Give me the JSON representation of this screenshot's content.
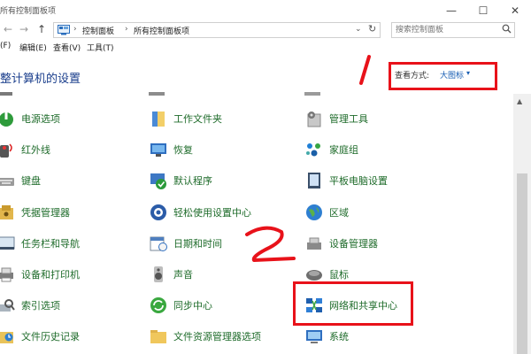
{
  "window": {
    "title": "所有控制面板项",
    "controls": {
      "minimize": "—",
      "maximize": "☐",
      "close": "✕"
    }
  },
  "address_bar": {
    "back": "←",
    "forward": "→",
    "up": "↑",
    "breadcrumb": [
      "控制面板",
      "所有控制面板项"
    ],
    "separator": "›",
    "dropdown": "⌄",
    "refresh": "↻"
  },
  "search": {
    "placeholder": "搜索控制面板"
  },
  "menu": [
    "(F)",
    "编辑(E)",
    "查看(V)",
    "工具(T)"
  ],
  "header": {
    "title": "整计算机的设置",
    "view_by_label": "查看方式:",
    "view_by_value": "大图标",
    "view_by_caret": "▾"
  },
  "annotations": {
    "one": "1",
    "two": "2"
  },
  "columns": [
    {
      "items": [
        {
          "label": "电源选项",
          "icon": "power-options-icon"
        },
        {
          "label": "红外线",
          "icon": "infrared-icon"
        },
        {
          "label": "键盘",
          "icon": "keyboard-icon"
        },
        {
          "label": "凭据管理器",
          "icon": "credential-manager-icon"
        },
        {
          "label": "任务栏和导航",
          "icon": "taskbar-icon"
        },
        {
          "label": "设备和打印机",
          "icon": "devices-printers-icon"
        },
        {
          "label": "索引选项",
          "icon": "indexing-options-icon"
        },
        {
          "label": "文件历史记录",
          "icon": "file-history-icon"
        }
      ]
    },
    {
      "items": [
        {
          "label": "工作文件夹",
          "icon": "work-folders-icon"
        },
        {
          "label": "恢复",
          "icon": "recovery-icon"
        },
        {
          "label": "默认程序",
          "icon": "default-programs-icon"
        },
        {
          "label": "轻松使用设置中心",
          "icon": "ease-of-access-icon"
        },
        {
          "label": "日期和时间",
          "icon": "date-time-icon"
        },
        {
          "label": "声音",
          "icon": "sound-icon"
        },
        {
          "label": "同步中心",
          "icon": "sync-center-icon"
        },
        {
          "label": "文件资源管理器选项",
          "icon": "explorer-options-icon"
        }
      ]
    },
    {
      "items": [
        {
          "label": "管理工具",
          "icon": "admin-tools-icon"
        },
        {
          "label": "家庭组",
          "icon": "homegroup-icon"
        },
        {
          "label": "平板电脑设置",
          "icon": "tablet-settings-icon"
        },
        {
          "label": "区域",
          "icon": "region-icon"
        },
        {
          "label": "设备管理器",
          "icon": "device-manager-icon"
        },
        {
          "label": "鼠标",
          "icon": "mouse-icon"
        },
        {
          "label": "网络和共享中心",
          "icon": "network-sharing-icon"
        },
        {
          "label": "系统",
          "icon": "system-icon"
        }
      ]
    }
  ],
  "colors": {
    "item_text": "#1e6b2a",
    "title_text": "#1a3e8c",
    "link": "#1a5fb4",
    "annotation": "#e8121a"
  }
}
